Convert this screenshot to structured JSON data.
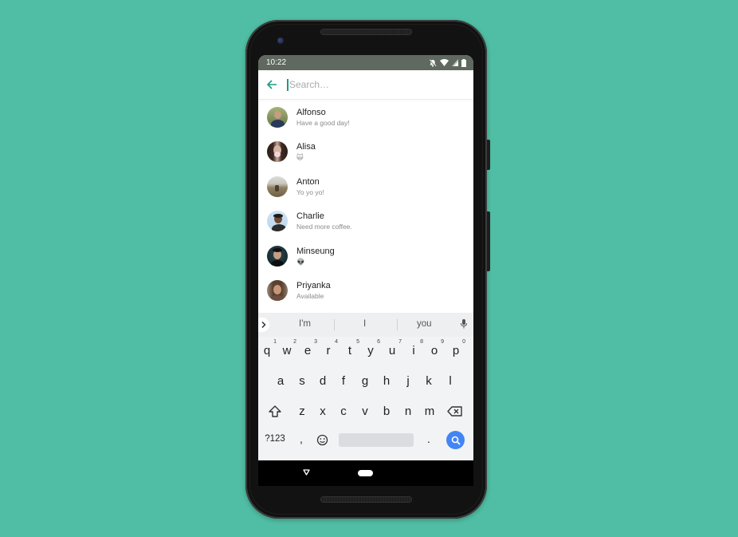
{
  "colors": {
    "background": "#50bea4",
    "accent": "#1e9a86",
    "status_bar": "#5f695f",
    "search_key": "#4285f4"
  },
  "status_bar": {
    "time": "10:22",
    "icons": [
      "notifications-off-icon",
      "wifi-icon",
      "signal-icon",
      "battery-icon"
    ]
  },
  "search": {
    "back_icon": "arrow-left-icon",
    "placeholder": "Search…",
    "value": ""
  },
  "contacts": [
    {
      "name": "Alfonso",
      "status": "Have a good day!"
    },
    {
      "name": "Alisa",
      "status": "🙀"
    },
    {
      "name": "Anton",
      "status": "Yo yo yo!"
    },
    {
      "name": "Charlie",
      "status": "Need more coffee."
    },
    {
      "name": "Minseung",
      "status": "👽"
    },
    {
      "name": "Priyanka",
      "status": "Available"
    }
  ],
  "keyboard": {
    "suggestions": [
      "I'm",
      "I",
      "you"
    ],
    "row1": [
      {
        "key": "q",
        "hint": "1"
      },
      {
        "key": "w",
        "hint": "2"
      },
      {
        "key": "e",
        "hint": "3"
      },
      {
        "key": "r",
        "hint": "4"
      },
      {
        "key": "t",
        "hint": "5"
      },
      {
        "key": "y",
        "hint": "6"
      },
      {
        "key": "u",
        "hint": "7"
      },
      {
        "key": "i",
        "hint": "8"
      },
      {
        "key": "o",
        "hint": "9"
      },
      {
        "key": "p",
        "hint": "0"
      }
    ],
    "row2": [
      "a",
      "s",
      "d",
      "f",
      "g",
      "h",
      "j",
      "k",
      "l"
    ],
    "row3": [
      "z",
      "x",
      "c",
      "v",
      "b",
      "n",
      "m"
    ],
    "symbols_label": "?123",
    "comma": ",",
    "period": "."
  },
  "nav_bar": {
    "buttons": [
      "back-icon",
      "home-icon"
    ]
  }
}
